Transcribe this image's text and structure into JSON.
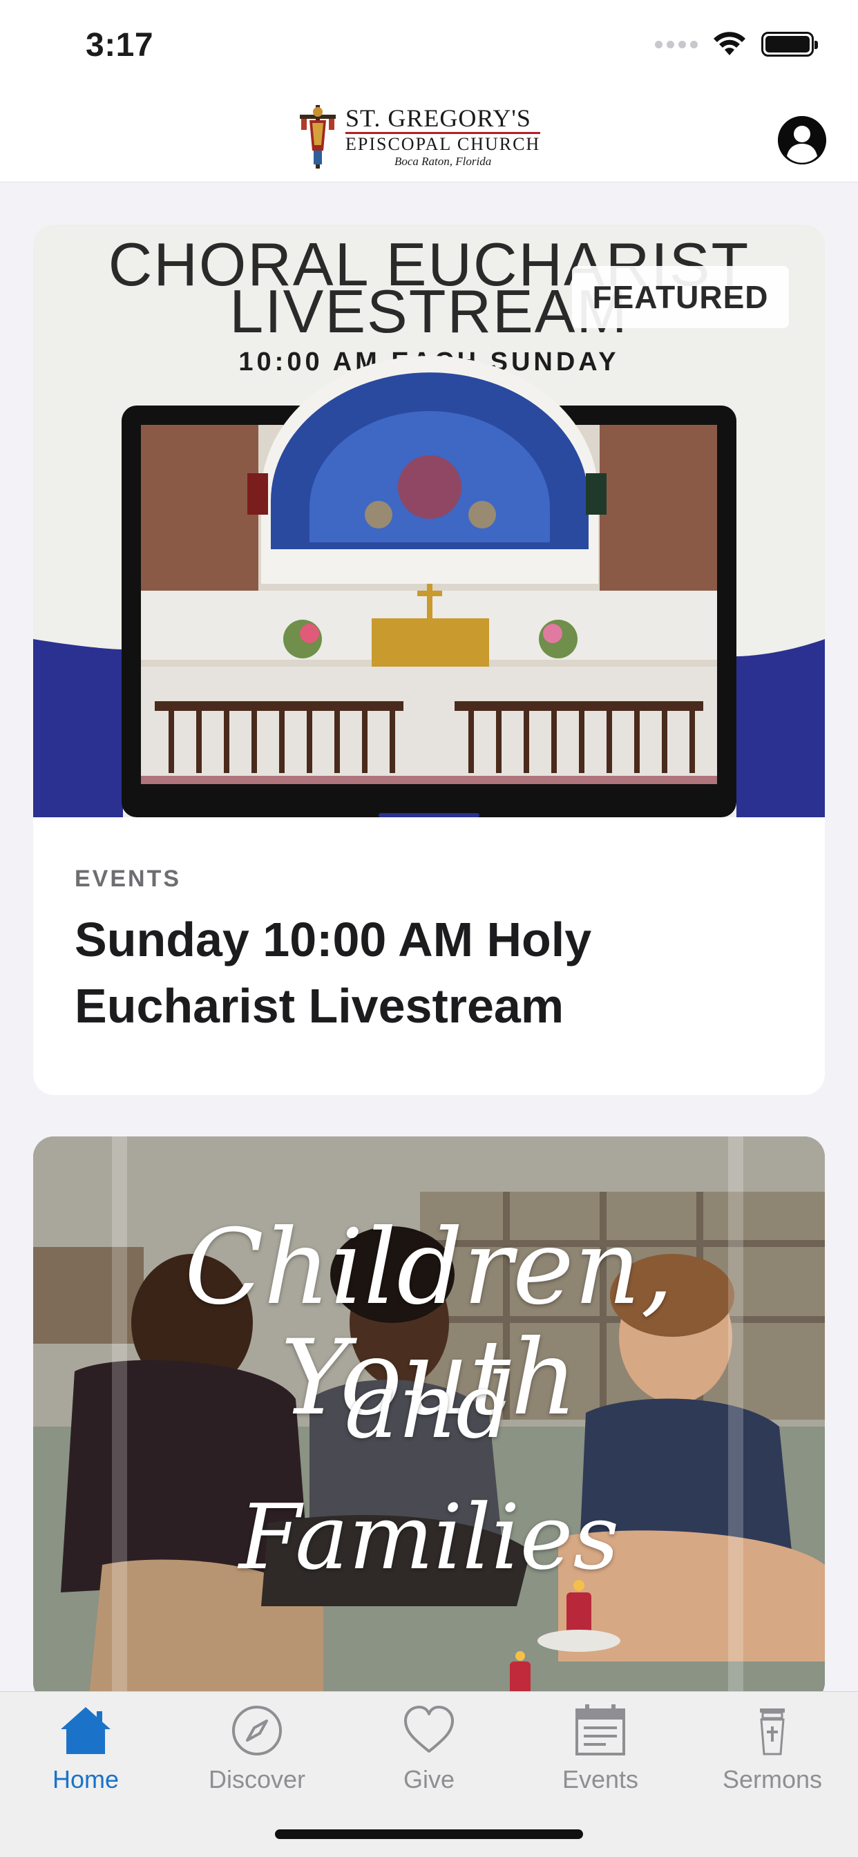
{
  "status_bar": {
    "time": "3:17",
    "icons": [
      "signal-icon",
      "wifi-icon",
      "battery-icon"
    ]
  },
  "header": {
    "logo": {
      "line1": "ST. GREGORY'S",
      "line2": "EPISCOPAL CHURCH",
      "line3": "Boca Raton, Florida"
    },
    "profile_icon": "person-icon"
  },
  "feed": {
    "cards": [
      {
        "image_title_line1": "CHORAL EUCHARIST",
        "image_title_line2": "LIVESTREAM",
        "image_subtitle": "10:00 AM EACH SUNDAY",
        "badge": "FEATURED",
        "category": "EVENTS",
        "title": "Sunday 10:00 AM Holy Eucharist Livestream"
      },
      {
        "image_title_line1": "Children, Youth",
        "image_title_line2": "and",
        "image_title_line3": "Families"
      }
    ]
  },
  "tab_bar": {
    "active": "Home",
    "tabs": [
      {
        "label": "Home",
        "icon": "home-icon"
      },
      {
        "label": "Discover",
        "icon": "compass-icon"
      },
      {
        "label": "Give",
        "icon": "heart-icon"
      },
      {
        "label": "Events",
        "icon": "calendar-icon"
      },
      {
        "label": "Sermons",
        "icon": "pulpit-icon"
      }
    ]
  },
  "colors": {
    "accent": "#1a73c9",
    "inactive": "#8e8e93",
    "background": "#f2f2f7",
    "hero_blue": "#2b3190"
  }
}
